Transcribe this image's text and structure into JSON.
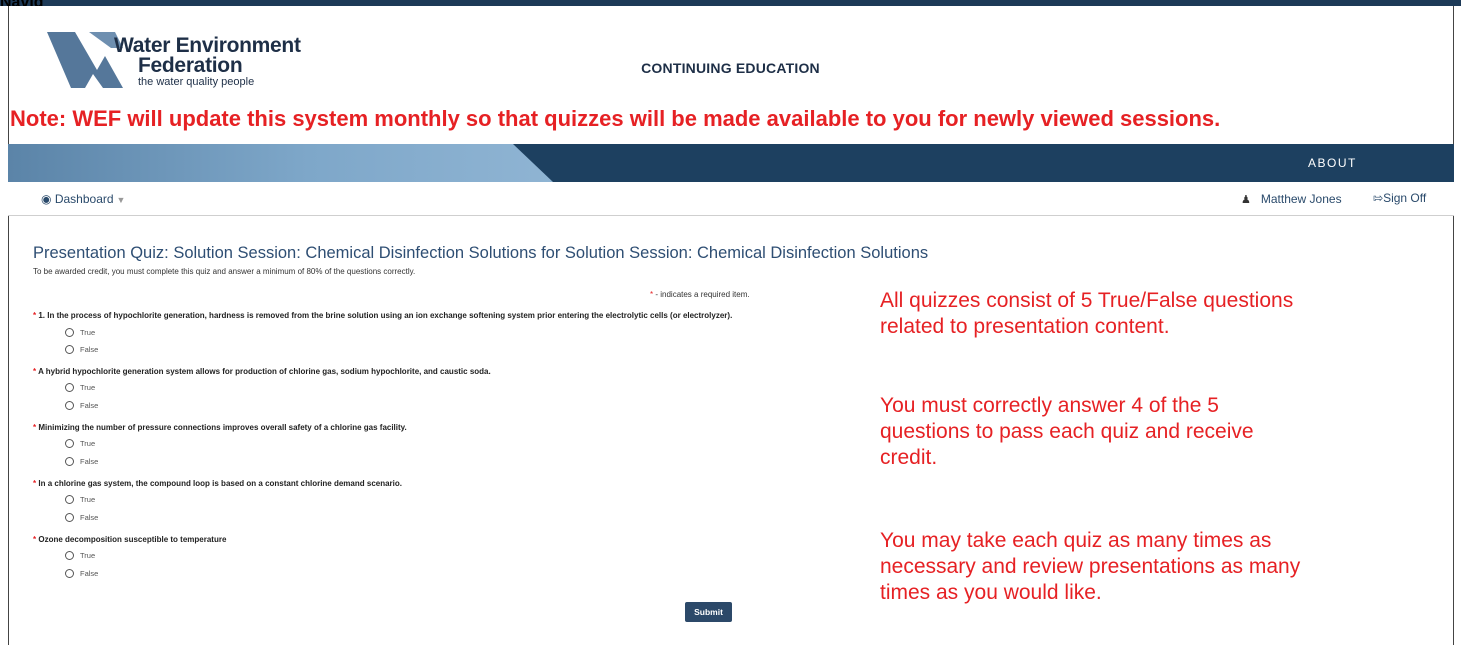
{
  "top_caption": "Navig",
  "logo": {
    "name_line1": "Water Environment",
    "name_line2": "Federation",
    "tagline": "the water quality people"
  },
  "header": {
    "center_label": "CONTINUING EDUCATION"
  },
  "note": "Note: WEF will update this system monthly so that quizzes will be made available to you for newly viewed sessions.",
  "nav": {
    "about": "ABOUT"
  },
  "subnav": {
    "dashboard": "Dashboard",
    "dashboard_icon": "dashboard-icon",
    "user_name": "Matthew Jones",
    "user_icon": "user-icon",
    "sign_off": "Sign Off",
    "sign_off_icon": "sign-out-icon"
  },
  "quiz": {
    "title": "Presentation Quiz: Solution Session: Chemical Disinfection Solutions for Solution Session: Chemical Disinfection Solutions",
    "subtitle": "To be awarded credit, you must complete this quiz and answer a minimum of 80% of the questions correctly.",
    "required_note": " - indicates a required item.",
    "required_star": "*",
    "questions": [
      {
        "text": "1. In the process of hypochlorite generation, hardness is removed from the brine solution using an ion exchange softening system prior entering the electrolytic cells (or electrolyzer).",
        "options": [
          "True",
          "False"
        ]
      },
      {
        "text": "A hybrid hypochlorite generation system allows for production of chlorine gas, sodium hypochlorite, and caustic soda.",
        "options": [
          "True",
          "False"
        ]
      },
      {
        "text": "Minimizing the number of pressure connections improves overall safety of a chlorine gas facility.",
        "options": [
          "True",
          "False"
        ]
      },
      {
        "text": "In a chlorine gas system, the compound loop is based on a constant chlorine demand scenario.",
        "options": [
          "True",
          "False"
        ]
      },
      {
        "text": "Ozone decomposition susceptible to temperature",
        "options": [
          "True",
          "False"
        ]
      }
    ],
    "submit": "Submit"
  },
  "annotations": {
    "a1": [
      "All quizzes consist of 5 True/False questions",
      "related to presentation content."
    ],
    "a2": [
      "You must correctly answer 4 of the 5",
      "questions to pass each quiz and receive",
      "credit."
    ],
    "a3": [
      "You may take each quiz as many times as",
      "necessary and review presentations as many",
      "times as you would like."
    ]
  },
  "colors": {
    "accent_red": "#e62124",
    "nav_dark": "#1d4060",
    "title_blue": "#2e4e73"
  }
}
